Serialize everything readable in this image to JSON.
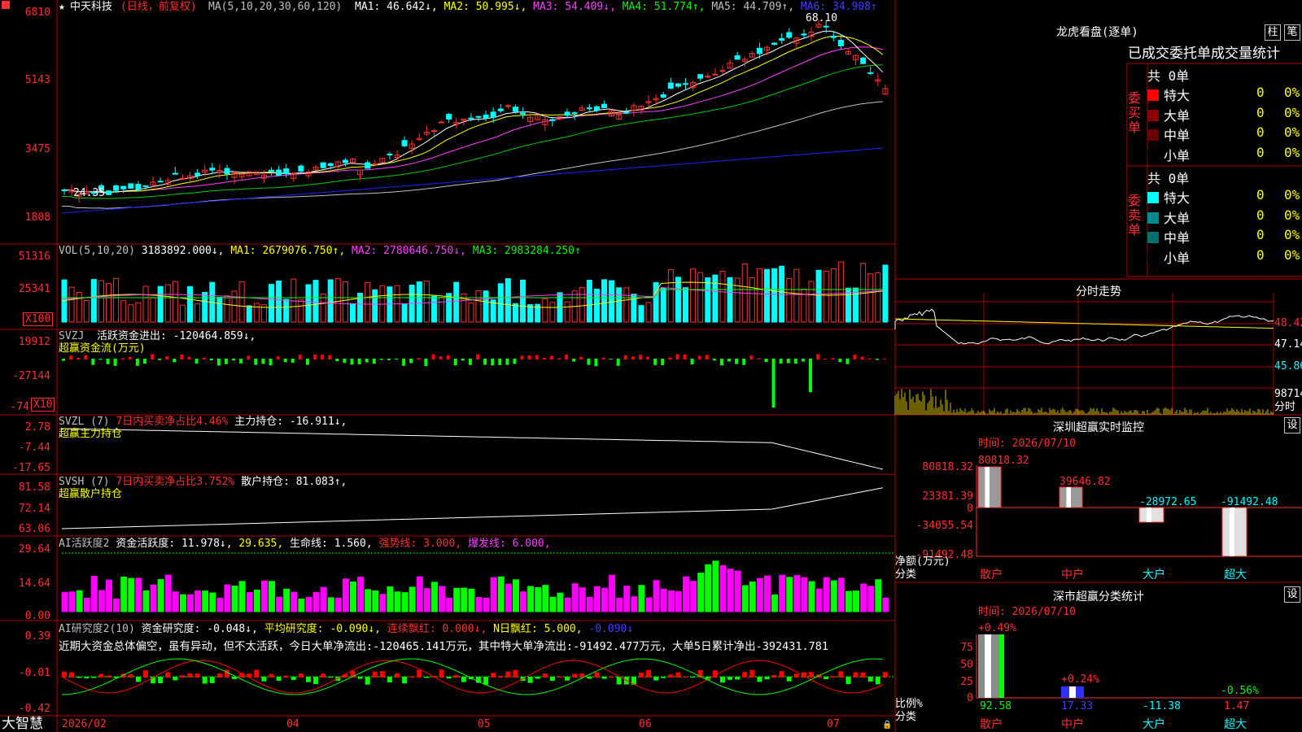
{
  "app": {
    "name": "大智慧",
    "stock_name": "中天科技",
    "mode": "(日线，前复权)"
  },
  "main_chart": {
    "ma_prefix": "MA(5,10,20,30,60,120)",
    "ma": [
      {
        "label": "MA1: 46.642↓,",
        "color": "#ffffff"
      },
      {
        "label": "MA2: 50.995↓,",
        "color": "#ffff00"
      },
      {
        "label": "MA3: 54.409↓,",
        "color": "#ff40ff"
      },
      {
        "label": "MA4: 51.774↑,",
        "color": "#00ff00"
      },
      {
        "label": "MA5: 44.709↑,",
        "color": "#c0c0c0"
      },
      {
        "label": "MA6: 34.908↑",
        "color": "#4040ff"
      }
    ],
    "y_ticks": [
      "6810",
      "5143",
      "3475",
      "1808"
    ],
    "high_label": "68.10",
    "low_label": "24.35"
  },
  "vol_panel": {
    "title": "VOL(5,10,20)",
    "value": "3183892.000↓,",
    "ma1": "MA1: 2679076.750↑,",
    "ma2": "MA2: 2780646.750↓,",
    "ma3": "MA3: 2983284.250↑",
    "y_ticks": [
      "51316",
      "25341"
    ],
    "unit": "X100"
  },
  "svzj_panel": {
    "title": "SVZJ",
    "value": "活跃资金进出: -120464.859↓,",
    "sub": "超赢资金流(万元)",
    "y_ticks": [
      "19912",
      "-27144",
      "-74"
    ],
    "unit": "X10"
  },
  "svzl_panel": {
    "title": "SVZL (7)",
    "desc": "7日内买卖净占比4.46%",
    "value": "主力持仓: -16.911↓,",
    "sub": "超赢主力持仓",
    "y_ticks": [
      "2.78",
      "-7.44",
      "-17.65"
    ]
  },
  "svsh_panel": {
    "title": "SVSH (7)",
    "desc": "7日内买卖净占比3.752%",
    "value": "散户持仓: 81.083↑,",
    "sub": "超赢散户持仓",
    "y_ticks": [
      "81.58",
      "72.14",
      "63.06"
    ]
  },
  "ai_active_panel": {
    "title": "AI活跃度2",
    "v1": "资金活跃度: 11.978↓,",
    "v2": "29.635,",
    "v3": "生命线: 1.560,",
    "v4": "强势线: 3.000,",
    "v5": "爆发线: 6.000,",
    "y_ticks": [
      "29.64",
      "14.64",
      "0.00"
    ]
  },
  "ai_research_panel": {
    "title": "AI研究度2(10)",
    "v1": "资金研究度: -0.048↓,",
    "v2": "平均研究度: -0.090↓,",
    "v3": "连续飘红: 0.000↓,",
    "v4": "N日飘红: 5.000,",
    "v5": "-0.090↓",
    "summary": "近期大资金总体偏空，虽有异动，但不太活跃，今日大单净流出:-120465.141万元，其中特大单净流出:-91492.477万元，大单5日累计净出-392431.781",
    "y_ticks": [
      "0.39",
      "-0.01",
      "-0.42"
    ]
  },
  "x_axis": {
    "labels": [
      "2026/02",
      "04",
      "05",
      "06",
      "07"
    ]
  },
  "right": {
    "lhb_title": "龙虎看盘(逐单)",
    "btn_bar": "柱",
    "btn_bi": "笔",
    "tabs_text": "已成交委托单成交量统计",
    "buy": {
      "label": "委买单",
      "total": "共 0单",
      "rows": [
        {
          "name": "特大",
          "v": "0",
          "p": "0%",
          "color": "#ff0000"
        },
        {
          "name": "大单",
          "v": "0",
          "p": "0%",
          "color": "#8b0000"
        },
        {
          "name": "中单",
          "v": "0",
          "p": "0%",
          "color": "#6a0000"
        },
        {
          "name": "小单",
          "v": "0",
          "p": "0%",
          "color": "#000000"
        }
      ]
    },
    "sell": {
      "label": "委卖单",
      "total": "共 0单",
      "rows": [
        {
          "name": "特大",
          "v": "0",
          "p": "0%",
          "color": "#00ffff"
        },
        {
          "name": "大单",
          "v": "0",
          "p": "0%",
          "color": "#008b8b"
        },
        {
          "name": "中单",
          "v": "0",
          "p": "0%",
          "color": "#007070"
        },
        {
          "name": "小单",
          "v": "0",
          "p": "0%",
          "color": "#000000"
        }
      ]
    },
    "intraday": {
      "title": "分时走势",
      "prices": [
        "48.42",
        "47.14",
        "45.86"
      ],
      "vol": "98714",
      "vol_unit": "分时"
    },
    "sz_monitor": {
      "title": "深圳超赢实时监控",
      "set": "设",
      "time": "时间: 2026/07/10",
      "y_ticks": [
        "80818.32",
        "23381.39",
        "0",
        "-34055.54",
        "-91492.48"
      ],
      "y_label": "净额(万元)",
      "x_label": "分类",
      "categories": [
        "散户",
        "中户",
        "大户",
        "超大"
      ],
      "values_text": [
        "80818.32",
        "39646.82",
        "-28972.65",
        "-91492.48"
      ]
    },
    "sz_class": {
      "title": "深市超赢分类统计",
      "set": "设",
      "time": "时间: 2026/07/10",
      "y_ticks": [
        "75",
        "50",
        "25",
        "0"
      ],
      "y_label": "比例%",
      "x_label": "分类",
      "categories": [
        "散户",
        "中户",
        "大户",
        "超大"
      ],
      "top_labels": [
        "+0.49%",
        "+0.24%",
        "",
        "-0.56%"
      ],
      "bottom_values": [
        "92.58",
        "17.33",
        "-11.38",
        "1.47"
      ]
    }
  }
}
